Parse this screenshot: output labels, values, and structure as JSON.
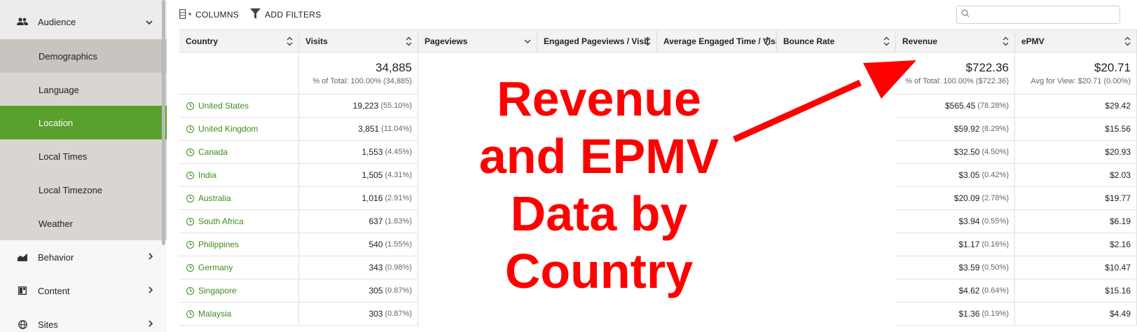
{
  "sidebar": {
    "groups": [
      {
        "label": "Audience",
        "icon": "people-icon",
        "expanded": true
      },
      {
        "label": "Behavior",
        "icon": "chart-area-icon",
        "expanded": false
      },
      {
        "label": "Content",
        "icon": "layout-icon",
        "expanded": false
      },
      {
        "label": "Sites",
        "icon": "globe-icon",
        "expanded": false
      }
    ],
    "sub_items": [
      "Demographics",
      "Language",
      "Location",
      "Local Times",
      "Local Timezone",
      "Weather"
    ],
    "active_item": "Location",
    "accent_color": "#5aa02c"
  },
  "toolbar": {
    "columns_label": "COLUMNS",
    "filters_label": "ADD FILTERS",
    "search_placeholder": ""
  },
  "table": {
    "headers": [
      "Country",
      "Visits",
      "Pageviews",
      "Engaged Pageviews / Visit",
      "Average Engaged Time / Visit",
      "Bounce Rate",
      "Revenue",
      "ePMV"
    ],
    "summary": {
      "visits": {
        "value": "34,885",
        "sub": "% of Total: 100.00% (34,885)"
      },
      "revenue": {
        "value": "$722.36",
        "sub": "% of Total: 100.00% ($722.36)"
      },
      "epmv": {
        "value": "$20.71",
        "sub": "Avg for View: $20.71 (0.00%)"
      }
    },
    "rows": [
      {
        "country": "United States",
        "visits": "19,223",
        "visits_pct": "(55.10%)",
        "revenue": "$565.45",
        "revenue_pct": "(78.28%)",
        "epmv": "$29.42"
      },
      {
        "country": "United Kingdom",
        "visits": "3,851",
        "visits_pct": "(11.04%)",
        "revenue": "$59.92",
        "revenue_pct": "(8.29%)",
        "epmv": "$15.56"
      },
      {
        "country": "Canada",
        "visits": "1,553",
        "visits_pct": "(4.45%)",
        "revenue": "$32.50",
        "revenue_pct": "(4.50%)",
        "epmv": "$20.93"
      },
      {
        "country": "India",
        "visits": "1,505",
        "visits_pct": "(4.31%)",
        "revenue": "$3.05",
        "revenue_pct": "(0.42%)",
        "epmv": "$2.03"
      },
      {
        "country": "Australia",
        "visits": "1,016",
        "visits_pct": "(2.91%)",
        "revenue": "$20.09",
        "revenue_pct": "(2.78%)",
        "epmv": "$19.77"
      },
      {
        "country": "South Africa",
        "visits": "637",
        "visits_pct": "(1.83%)",
        "revenue": "$3.94",
        "revenue_pct": "(0.55%)",
        "epmv": "$6.19"
      },
      {
        "country": "Philippines",
        "visits": "540",
        "visits_pct": "(1.55%)",
        "revenue": "$1.17",
        "revenue_pct": "(0.16%)",
        "epmv": "$2.16"
      },
      {
        "country": "Germany",
        "visits": "343",
        "visits_pct": "(0.98%)",
        "revenue": "$3.59",
        "revenue_pct": "(0.50%)",
        "epmv": "$10.47"
      },
      {
        "country": "Singapore",
        "visits": "305",
        "visits_pct": "(0.87%)",
        "revenue": "$4.62",
        "revenue_pct": "(0.64%)",
        "epmv": "$15.16"
      },
      {
        "country": "Malaysia",
        "visits": "303",
        "visits_pct": "(0.87%)",
        "revenue": "$1.36",
        "revenue_pct": "(0.19%)",
        "epmv": "$4.49"
      }
    ]
  },
  "annotation": {
    "lines": [
      "Revenue",
      "and EPMV",
      "Data by",
      "Country"
    ],
    "color": "#ff0000"
  }
}
